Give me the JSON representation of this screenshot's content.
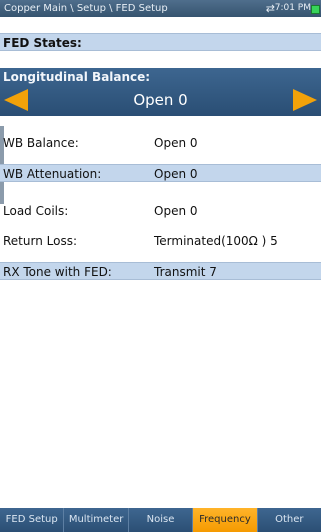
{
  "titlebar": {
    "breadcrumb": "Copper Main \\ Setup \\ FED Setup",
    "connection_icon": "⇄",
    "clock": "7:01 PM"
  },
  "fed_states": {
    "label": "FED States:"
  },
  "selector": {
    "label": "Longitudinal Balance:",
    "value": "Open 0"
  },
  "rows": [
    {
      "label": "WB Balance:",
      "value": "Open 0"
    },
    {
      "label": "WB Attenuation:",
      "value": "Open 0"
    },
    {
      "label": "Load Coils:",
      "value": "Open 0"
    },
    {
      "label": "Return Loss:",
      "value": "Terminated(100Ω ) 5"
    },
    {
      "label": "RX Tone with FED:",
      "value": "Transmit 7"
    }
  ],
  "tabs": [
    {
      "label": "FED Setup"
    },
    {
      "label": "Multimeter"
    },
    {
      "label": "Noise"
    },
    {
      "label": "Frequency"
    },
    {
      "label": "Other"
    }
  ],
  "colors": {
    "accent": "#f2a20a",
    "row_shade": "#c3d6ec",
    "header_blue": "#2d4f73"
  }
}
